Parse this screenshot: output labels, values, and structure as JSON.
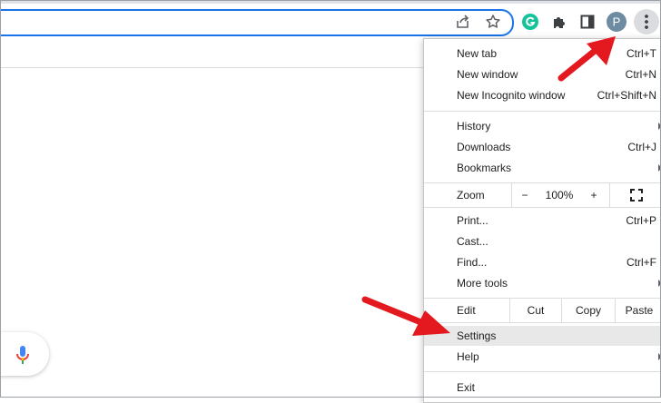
{
  "toolbar": {
    "share_icon": "share-icon",
    "bookmark_icon": "star-icon",
    "extensions": [
      {
        "name": "grammarly-extension-icon",
        "letter": "G",
        "color": "#15c39a"
      },
      {
        "name": "puzzle-extensions-icon"
      },
      {
        "name": "side-panel-icon"
      }
    ],
    "profile_letter": "P",
    "profile_color": "#6e8ca1",
    "menu_icon": "three-dots-vertical-icon"
  },
  "menu": {
    "new_tab": {
      "label": "New tab",
      "shortcut": "Ctrl+T"
    },
    "new_window": {
      "label": "New window",
      "shortcut": "Ctrl+N"
    },
    "new_incognito": {
      "label": "New Incognito window",
      "shortcut": "Ctrl+Shift+N"
    },
    "history": {
      "label": "History"
    },
    "downloads": {
      "label": "Downloads",
      "shortcut": "Ctrl+J"
    },
    "bookmarks": {
      "label": "Bookmarks"
    },
    "zoom": {
      "label": "Zoom",
      "minus": "−",
      "level": "100%",
      "plus": "+"
    },
    "print": {
      "label": "Print...",
      "shortcut": "Ctrl+P"
    },
    "cast": {
      "label": "Cast..."
    },
    "find": {
      "label": "Find...",
      "shortcut": "Ctrl+F"
    },
    "more_tools": {
      "label": "More tools"
    },
    "edit": {
      "label": "Edit",
      "cut": "Cut",
      "copy": "Copy",
      "paste": "Paste"
    },
    "settings": {
      "label": "Settings"
    },
    "help": {
      "label": "Help"
    },
    "exit": {
      "label": "Exit"
    }
  },
  "colors": {
    "accent": "#1a73e8",
    "annotation_arrow": "#e3191f",
    "highlight": "#e8e8e8"
  }
}
